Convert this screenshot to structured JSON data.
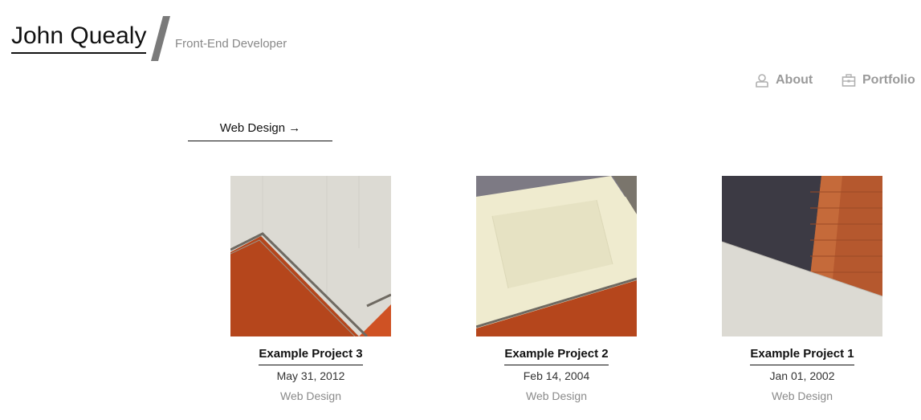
{
  "header": {
    "site_title": "John Quealy",
    "tagline": "Front-End Developer"
  },
  "nav": {
    "items": [
      {
        "label": "About",
        "icon": "user-icon"
      },
      {
        "label": "Portfolio",
        "icon": "briefcase-icon"
      }
    ]
  },
  "filter": {
    "label": "Web Design →"
  },
  "projects": [
    {
      "title": "Example Project 3",
      "date": "May 31, 2012",
      "category": "Web Design"
    },
    {
      "title": "Example Project 2",
      "date": "Feb 14, 2004",
      "category": "Web Design"
    },
    {
      "title": "Example Project 1",
      "date": "Jan 01, 2002",
      "category": "Web Design"
    }
  ],
  "colors": {
    "accent_orange": "#b5461c",
    "concrete": "#dcdad3",
    "nav_gray": "#9a9a9a"
  }
}
